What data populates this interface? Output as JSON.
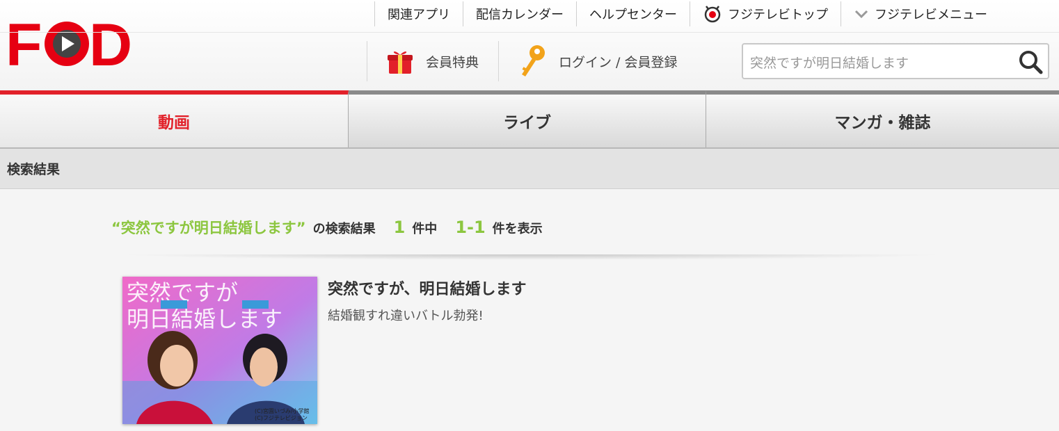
{
  "brand": {
    "logo_text": "FOD",
    "brand_color": "#e60012"
  },
  "top_links": [
    {
      "label": "関連アプリ"
    },
    {
      "label": "配信カレンダー"
    },
    {
      "label": "ヘルプセンター"
    },
    {
      "label": "フジテレビトップ",
      "icon": "fujitv-eye-icon"
    },
    {
      "label": "フジテレビメニュー",
      "icon": "chevron-down-icon"
    }
  ],
  "account": {
    "benefits_label": "会員特典",
    "login_label": "ログイン / 会員登録"
  },
  "search": {
    "value": "突然ですが明日結婚します",
    "icon": "search-icon"
  },
  "tabs": [
    {
      "label": "動画",
      "active": true
    },
    {
      "label": "ライブ"
    },
    {
      "label": "マンガ・雑誌"
    }
  ],
  "section_title": "検索結果",
  "summary": {
    "query": "“突然ですが明日結婚します”",
    "text1": "の検索結果",
    "total": "1",
    "text2": "件中",
    "range": "1-1",
    "text3": "件を表示"
  },
  "results": [
    {
      "title": "突然ですが、明日結婚します",
      "description": "結婚観すれ違いバトル勃発!",
      "thumb_title_line1": "突然ですが",
      "thumb_title_line2": "明日結婚します",
      "thumb_credit_1": "(C)宮園いづみ/小学館",
      "thumb_credit_2": "(C)フジテレビジョン"
    }
  ],
  "colors": {
    "accent_red": "#e2212a",
    "accent_green": "#8cc63f"
  }
}
